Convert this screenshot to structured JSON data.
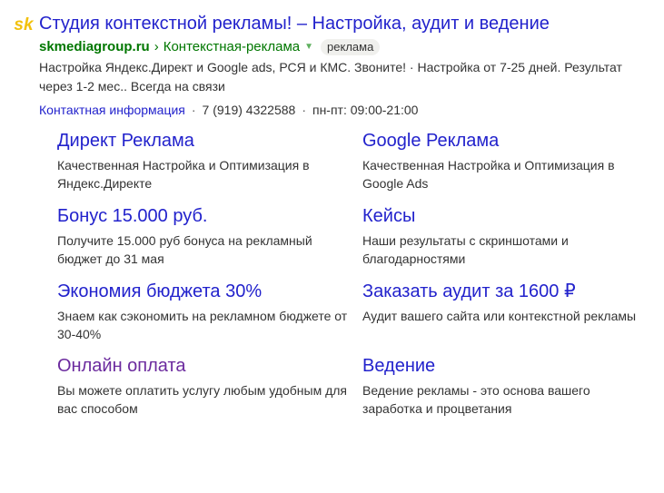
{
  "ad": {
    "favicon_letters": "sk",
    "title": "Студия контекстной рекламы! – Настройка, аудит и ведение",
    "domain": "skmediagroup.ru",
    "breadcrumb_sep": "›",
    "path": "Контекстная-реклама",
    "badge": "реклама",
    "description": "Настройка Яндекс.Директ и Google ads, РСЯ и КМС. Звоните! · Настройка от 7-25 дней. Результат через 1-2 мес.. Всегда на связи",
    "contact": {
      "label": "Контактная информация",
      "dot1": "·",
      "phone": "7 (919) 4322588",
      "dot2": "·",
      "hours": "пн-пт: 09:00-21:00"
    }
  },
  "sitelinks": [
    {
      "title": "Директ Реклама",
      "desc": "Качественная Настройка и Оптимизация в Яндекс.Директе"
    },
    {
      "title": "Google Реклама",
      "desc": "Качественная Настройка и Оптимизация в Google Ads"
    },
    {
      "title": "Бонус 15.000 руб.",
      "desc": "Получите 15.000 руб бонуса на рекламный бюджет до 31 мая"
    },
    {
      "title": "Кейсы",
      "desc": "Наши результаты с скриншотами и благодарностями"
    },
    {
      "title": "Экономия бюджета 30%",
      "desc": "Знаем как сэкономить на рекламном бюджете от 30-40%"
    },
    {
      "title": "Заказать аудит за 1600 ₽",
      "desc": "Аудит вашего сайта или контекстной рекламы"
    },
    {
      "title": "Онлайн оплата",
      "desc": "Вы можете оплатить услугу любым удобным для вас способом"
    },
    {
      "title": "Ведение",
      "desc": "Ведение рекламы - это основа вашего заработка и процветания"
    }
  ],
  "colors": {
    "link": "#2222cc",
    "visited_link": "#6b2a9e",
    "url_green": "#007700",
    "favicon_yellow": "#f2c10c"
  }
}
